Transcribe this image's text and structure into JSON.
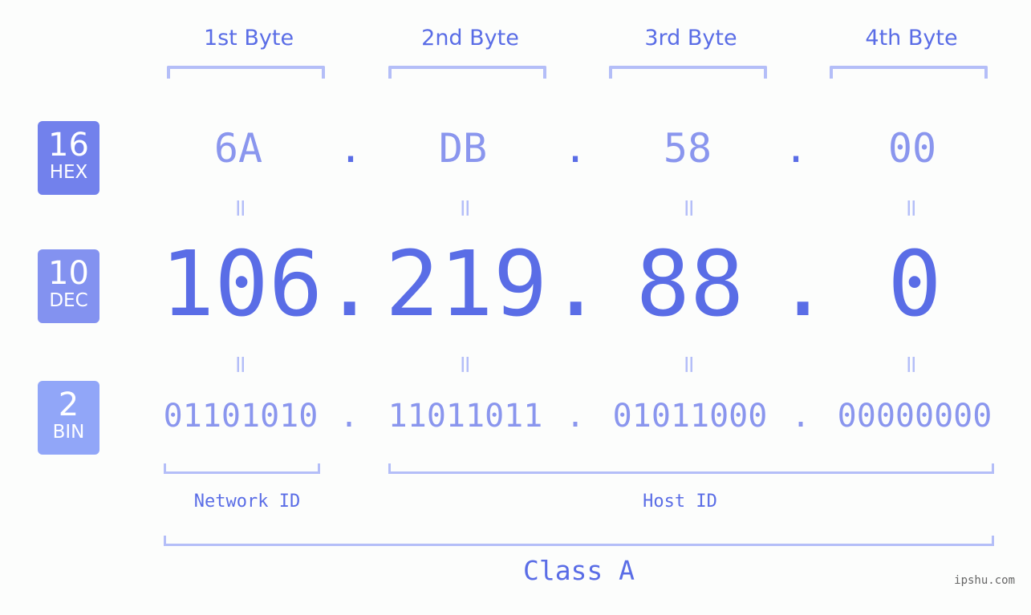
{
  "header": {
    "byte_labels": [
      "1st Byte",
      "2nd Byte",
      "3rd Byte",
      "4th Byte"
    ]
  },
  "badges": {
    "hex": {
      "number": "16",
      "unit": "HEX",
      "color": "#7281ec"
    },
    "dec": {
      "number": "10",
      "unit": "DEC",
      "color": "#8392f0"
    },
    "bin": {
      "number": "2",
      "unit": "BIN",
      "color": "#91a6f8"
    }
  },
  "ip": {
    "separator": ".",
    "equals": "=",
    "hex": [
      "6A",
      "DB",
      "58",
      "00"
    ],
    "dec": [
      "106",
      "219",
      "88",
      "0"
    ],
    "bin": [
      "01101010",
      "11011011",
      "01011000",
      "00000000"
    ]
  },
  "segments": {
    "network_id": "Network ID",
    "host_id": "Host ID",
    "class": "Class A"
  },
  "colors": {
    "accent": "#5a6de6",
    "light": "#8a96ee",
    "bracket": "#b4bef8"
  },
  "watermark": "ipshu.com"
}
